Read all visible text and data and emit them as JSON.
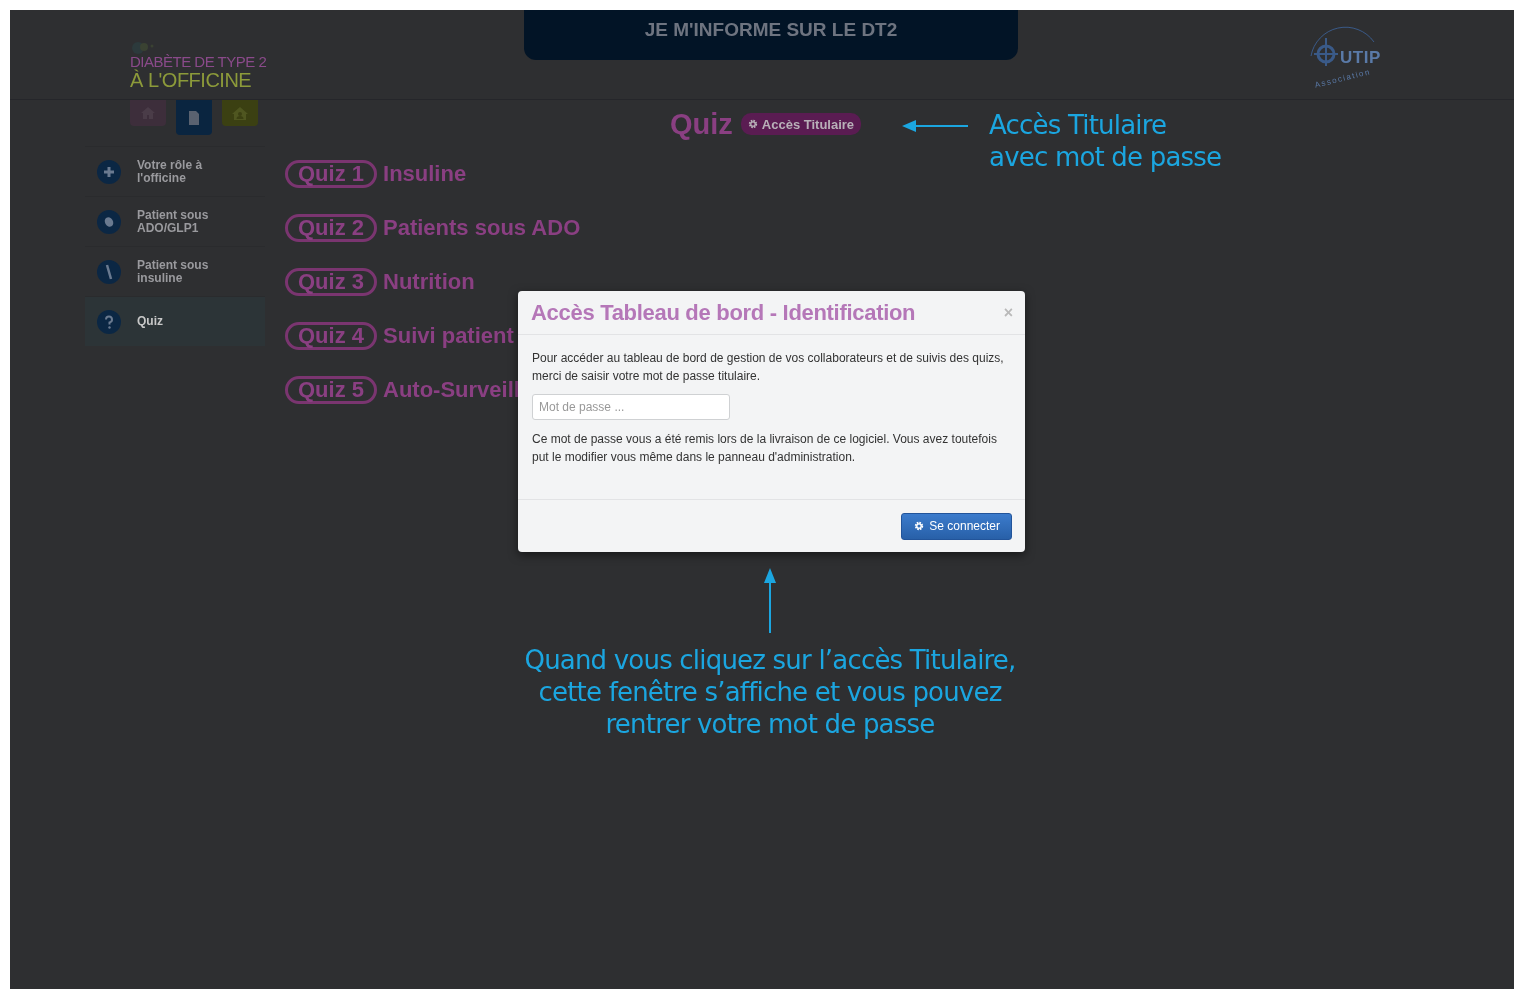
{
  "header": {
    "logo": {
      "line_1": "DIABÈTE DE TYPE 2",
      "line_2": "À L'OFFICINE"
    },
    "banner": "JE M'INFORME SUR LE DT2",
    "partner_logo": {
      "name": "UTIP",
      "subtitle": "Association"
    }
  },
  "sidebar": {
    "tabs": [
      {
        "kind": "home",
        "selected": false
      },
      {
        "kind": "document",
        "selected": true
      },
      {
        "kind": "person-home",
        "selected": false
      }
    ],
    "items": [
      {
        "kind": "plus",
        "label": "Votre rôle à l'officine",
        "selected": false
      },
      {
        "kind": "pill",
        "label": "Patient sous ADO/GLP1",
        "selected": false
      },
      {
        "kind": "syringe",
        "label": "Patient sous insuline",
        "selected": false
      },
      {
        "kind": "question",
        "label": "Quiz",
        "selected": true
      }
    ]
  },
  "main": {
    "title": "Quiz",
    "access_button": "Accès Titulaire",
    "quizzes": [
      {
        "tag": "Quiz 1",
        "title": "Insuline"
      },
      {
        "tag": "Quiz 2",
        "title": "Patients sous ADO"
      },
      {
        "tag": "Quiz 3",
        "title": "Nutrition"
      },
      {
        "tag": "Quiz 4",
        "title": "Suivi patient"
      },
      {
        "tag": "Quiz 5",
        "title": "Auto-Surveill"
      }
    ]
  },
  "dialog": {
    "title": "Accès Tableau de bord - Identification",
    "close": "×",
    "intro": "Pour accéder au tableau de bord de gestion de vos collaborateurs et de suivis des quizs, merci de saisir votre mot de passe titulaire.",
    "password": {
      "placeholder": "Mot de passe ..."
    },
    "note": "Ce mot de passe vous a été remis lors de la livraison de ce logiciel. Vous avez toutefois put le modifier vous même dans le panneau d'administration.",
    "button": "Se connecter"
  },
  "annotations": [
    {
      "kind": "left-arrow",
      "lines": [
        "Accès Titulaire",
        "avec mot de passe"
      ]
    },
    {
      "kind": "up-arrow",
      "lines": [
        "Quand vous cliquez sur l’accès Titulaire,",
        "cette fenêtre s’affiche et vous pouvez",
        "rentrer votre mot de passe"
      ]
    }
  ]
}
